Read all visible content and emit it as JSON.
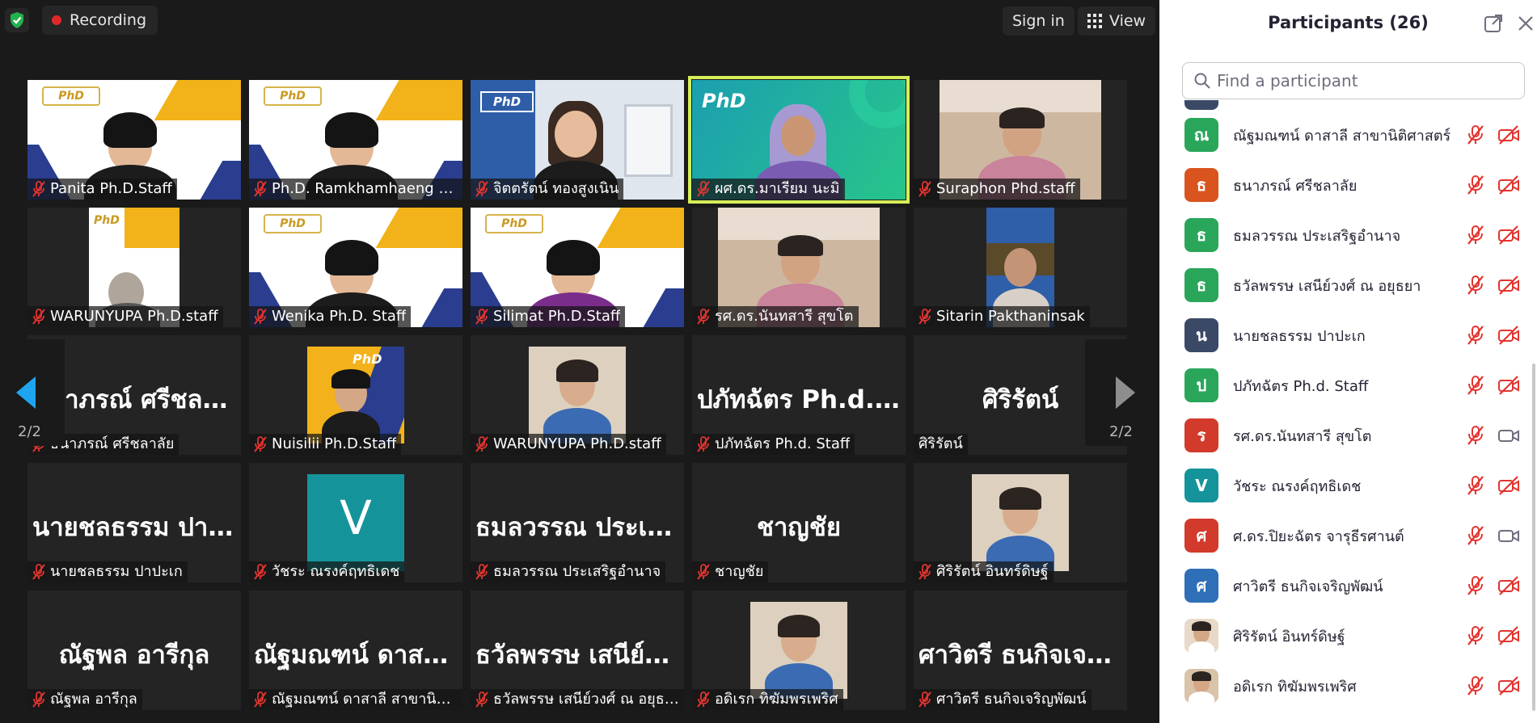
{
  "topbar": {
    "recording_label": "Recording",
    "signin_label": "Sign in",
    "view_label": "View"
  },
  "gallery": {
    "page_indicator_left": "2/2",
    "page_indicator_right": "2/2",
    "tiles": [
      {
        "name": "Panita Ph.D.Staff",
        "kind": "video-phd",
        "big": ""
      },
      {
        "name": "Ph.D. Ramkhamhaeng Un...",
        "kind": "video-phd",
        "big": ""
      },
      {
        "name": "จิตตรัตน์ ทองสูงเนิน",
        "kind": "video-blue",
        "big": ""
      },
      {
        "name": "ผศ.ดร.มาเรียม นะมิ",
        "kind": "video-green",
        "big": "",
        "active": true
      },
      {
        "name": "Suraphon Phd.staff",
        "kind": "video-room",
        "big": ""
      },
      {
        "name": "WARUNYUPA Ph.D.staff",
        "kind": "video-small-phd",
        "big": ""
      },
      {
        "name": "Wenika Ph.D. Staff",
        "kind": "video-phd",
        "big": ""
      },
      {
        "name": "Silimat Ph.D.Staff",
        "kind": "video-phd-purple",
        "big": ""
      },
      {
        "name": "รศ.ดร.นันทสารี  สุขโต",
        "kind": "video-room",
        "big": ""
      },
      {
        "name": "Sitarin Pakthaninsak",
        "kind": "video-portrait",
        "big": ""
      },
      {
        "name": "ธนาภรณ์ ศรีชลาลัย",
        "kind": "name",
        "big": "ธนาภรณ์ ศรีชลาลัย"
      },
      {
        "name": "Nuisilii Ph.D.Staff",
        "kind": "photo-phd",
        "big": ""
      },
      {
        "name": "WARUNYUPA Ph.D.staff",
        "kind": "photo",
        "big": ""
      },
      {
        "name": "ปภัทฉัตร Ph.d. Staff",
        "kind": "name",
        "big": "ปภัทฉัตร Ph.d. S..."
      },
      {
        "name": "ศิริรัตน์",
        "kind": "name-nomic",
        "big": "ศิริรัตน์"
      },
      {
        "name": "นายชลธรรม ปาปะเก",
        "kind": "name",
        "big": "นายชลธรรม ปาป...."
      },
      {
        "name": "วัชระ ณรงค์ฤทธิเดช",
        "kind": "letter",
        "big": "V"
      },
      {
        "name": "ธมลวรรณ ประเสริฐอำนาจ",
        "kind": "name",
        "big": "ธมลวรรณ ประเส..."
      },
      {
        "name": "ชาญชัย",
        "kind": "name",
        "big": "ชาญชัย"
      },
      {
        "name": "ศิริรัตน์ อินทร์ดิษฐ์",
        "kind": "photo",
        "big": ""
      },
      {
        "name": "ณัฐพล อารีกุล",
        "kind": "name",
        "big": "ณัฐพล อารีกุล"
      },
      {
        "name": "ณัฐมณฑน์ ดาสาลี สาขานิติศ...",
        "kind": "name",
        "big": "ณัฐมณฑน์ ดาสาลี..."
      },
      {
        "name": "ธวัลพรรษ เสนีย์วงศ์ ณ อยุธยา",
        "kind": "name",
        "big": "ธวัลพรรษ เสนีย์ว..."
      },
      {
        "name": "อดิเรก ทิฆัมพรเพริศ",
        "kind": "photo",
        "big": ""
      },
      {
        "name": "ศาวิตรี ธนกิจเจริญพัฒน์",
        "kind": "name",
        "big": "ศาวิตรี ธนกิจเจริ..."
      }
    ]
  },
  "panel": {
    "title": "Participants (26)",
    "search_placeholder": "Find a participant",
    "participants": [
      {
        "name": "ณัฐมณฑน์ ดาสาลี สาขานิติศาสตร์",
        "initial": "ณ",
        "color": "#2aa65b",
        "cam": "off"
      },
      {
        "name": "ธนาภรณ์ ศรีชลาลัย",
        "initial": "ธ",
        "color": "#d9541e",
        "cam": "off"
      },
      {
        "name": "ธมลวรรณ ประเสริฐอำนาจ",
        "initial": "ธ",
        "color": "#2aa65b",
        "cam": "off"
      },
      {
        "name": "ธวัลพรรษ เสนีย์วงศ์ ณ อยุธยา",
        "initial": "ธ",
        "color": "#2aa65b",
        "cam": "off"
      },
      {
        "name": "นายชลธรรม ปาปะเก",
        "initial": "น",
        "color": "#3a4a66",
        "cam": "off"
      },
      {
        "name": "ปภัทฉัตร Ph.d. Staff",
        "initial": "ป",
        "color": "#2aa65b",
        "cam": "off"
      },
      {
        "name": "รศ.ดร.นันทสารี  สุขโต",
        "initial": "ร",
        "color": "#d23a2c",
        "cam": "on"
      },
      {
        "name": "วัชระ ณรงค์ฤทธิเดช",
        "initial": "V",
        "color": "#14949a",
        "cam": "off"
      },
      {
        "name": "ศ.ดร.ปิยะฉัตร จารุธีรศานต์",
        "initial": "ศ",
        "color": "#d23a2c",
        "cam": "on"
      },
      {
        "name": "ศาวิตรี ธนกิจเจริญพัฒน์",
        "initial": "ศ",
        "color": "#2f6fb8",
        "cam": "off"
      },
      {
        "name": "ศิริรัตน์ อินทร์ดิษฐ์",
        "initial": "",
        "color": "#e8d9c8",
        "cam": "off"
      },
      {
        "name": "อดิเรก ทิฆัมพรเพริศ",
        "initial": "",
        "color": "#d9c3a9",
        "cam": "off"
      }
    ]
  }
}
